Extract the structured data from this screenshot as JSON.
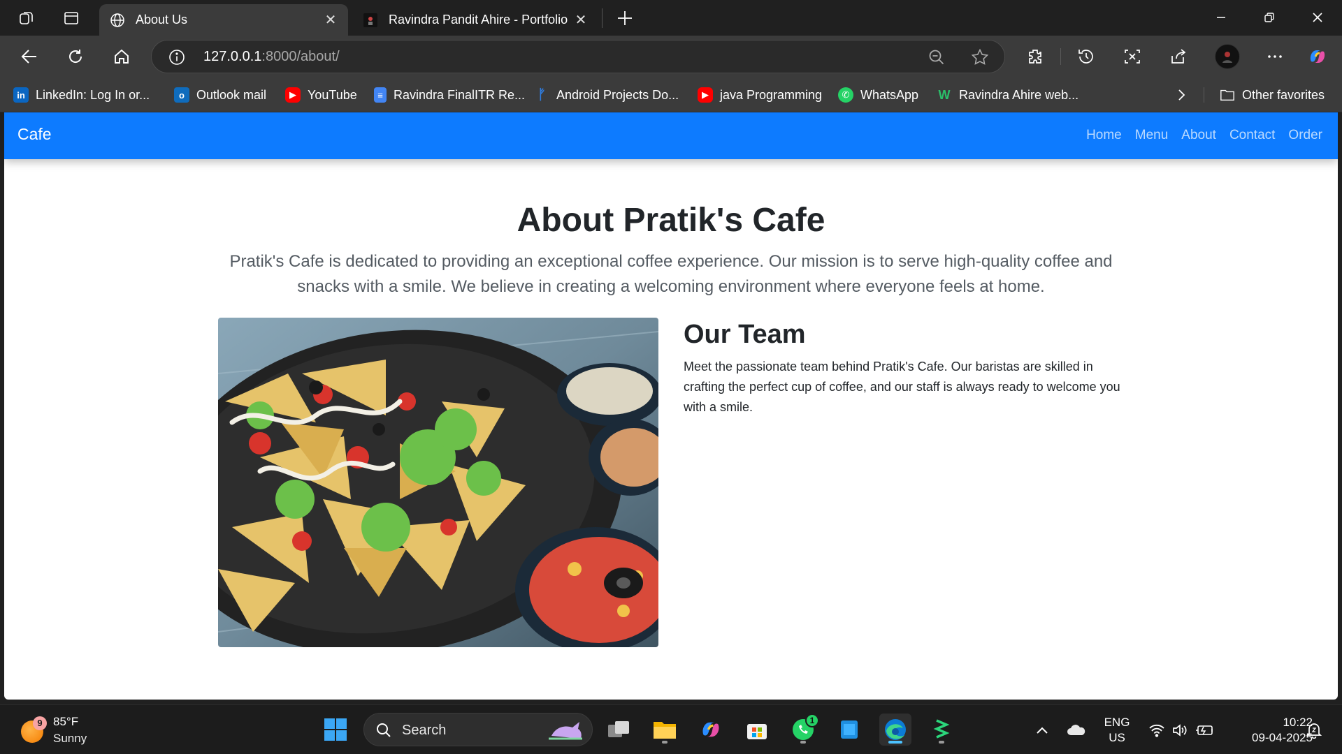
{
  "browser": {
    "tabs": [
      {
        "title": "About Us",
        "active": true
      },
      {
        "title": "Ravindra Pandit Ahire - Portfolio",
        "active": false
      }
    ],
    "url_host": "127.0.0.1",
    "url_path": ":8000/about/",
    "bookmarks": [
      {
        "label": "LinkedIn: Log In or...",
        "icon": "linkedin-icon"
      },
      {
        "label": "Outlook mail",
        "icon": "outlook-icon"
      },
      {
        "label": "YouTube",
        "icon": "youtube-icon"
      },
      {
        "label": "Ravindra FinalITR Re...",
        "icon": "docs-icon"
      },
      {
        "label": "Android Projects Do...",
        "icon": "flutter-icon"
      },
      {
        "label": "java Programming",
        "icon": "youtube-icon"
      },
      {
        "label": "WhatsApp",
        "icon": "whatsapp-icon"
      },
      {
        "label": "Ravindra Ahire web...",
        "icon": "web-icon"
      }
    ],
    "other_favorites": "Other favorites"
  },
  "site": {
    "brand": "Cafe",
    "nav": [
      "Home",
      "Menu",
      "About",
      "Contact",
      "Order"
    ],
    "heading": "About Pratik's Cafe",
    "lead": "Pratik's Cafe is dedicated to providing an exceptional coffee experience. Our mission is to serve high-quality coffee and snacks with a smile. We believe in creating a welcoming environment where everyone feels at home.",
    "team_heading": "Our Team",
    "team_text": "Meet the passionate team behind Pratik's Cafe. Our baristas are skilled in crafting the perfect cup of coffee, and our staff is always ready to welcome you with a smile.",
    "accent_color": "#0d7bff"
  },
  "taskbar": {
    "weather_badge": "9",
    "temperature": "85°F",
    "condition": "Sunny",
    "search_label": "Search",
    "whatsapp_badge": "1",
    "lang_line1": "ENG",
    "lang_line2": "US",
    "time": "10:22",
    "date": "09-04-2025"
  }
}
